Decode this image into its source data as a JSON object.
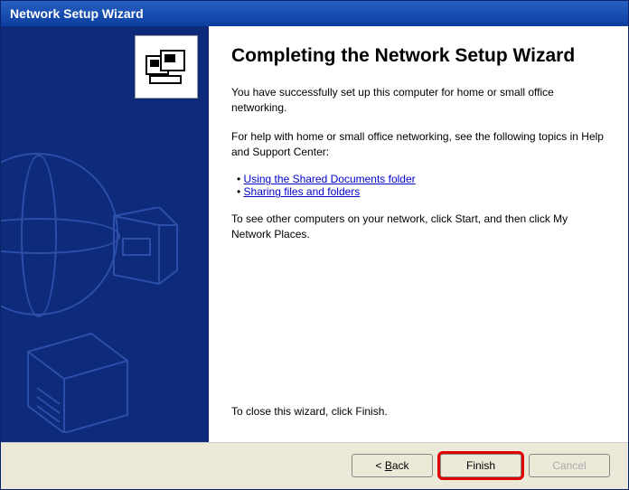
{
  "window": {
    "title": "Network Setup Wizard"
  },
  "main": {
    "heading": "Completing the Network Setup Wizard",
    "para1": "You have successfully set up this computer for home or small office networking.",
    "para2": "For help with home or small office networking, see the following topics in Help and Support Center:",
    "links": [
      "Using the Shared Documents folder",
      "Sharing files and folders"
    ],
    "para3": "To see other computers on your network, click Start, and then click My Network Places.",
    "para4": "To close this wizard, click Finish."
  },
  "buttons": {
    "back": "< Back",
    "finish": "Finish",
    "cancel": "Cancel"
  },
  "icon": {
    "name": "network-computers-icon"
  }
}
